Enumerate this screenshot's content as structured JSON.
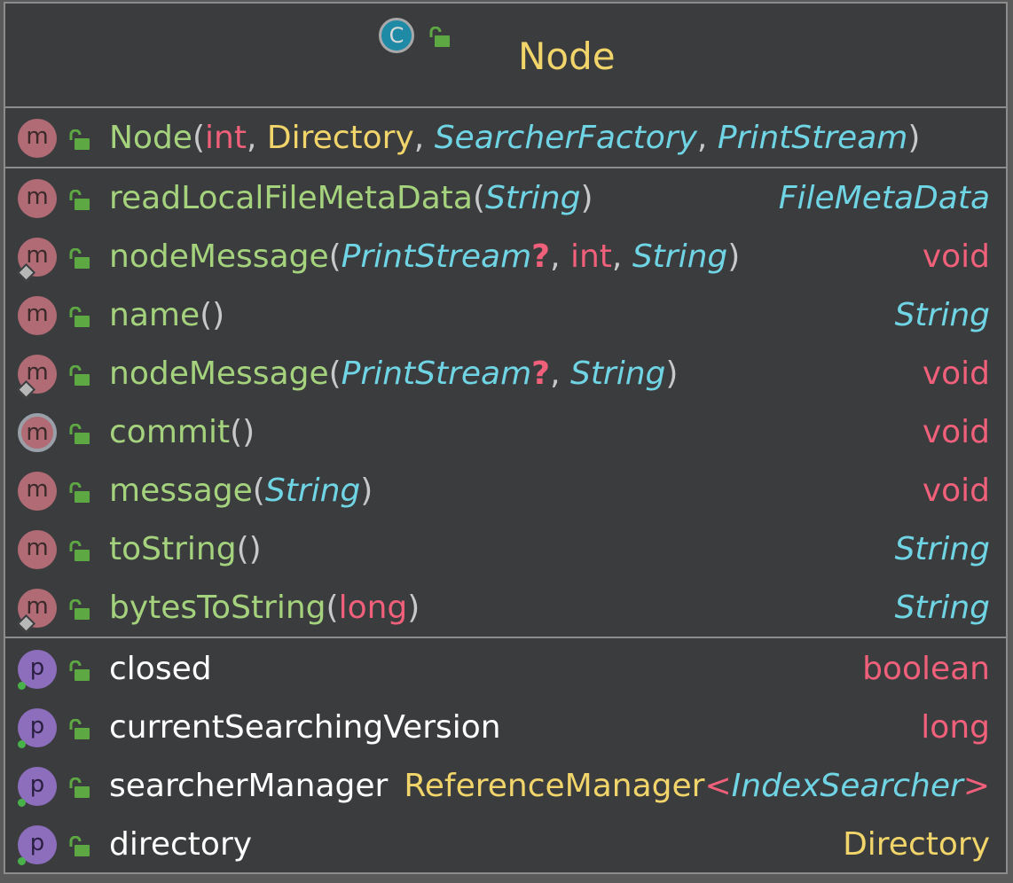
{
  "class": {
    "icon_letter": "C",
    "name": "Node"
  },
  "constructor": {
    "icon_letter": "m",
    "name": "Node",
    "params": [
      "int",
      "Directory",
      "SearcherFactory",
      "PrintStream"
    ]
  },
  "methods": [
    {
      "icon_letter": "m",
      "name": "readLocalFileMetaData",
      "param1": "String",
      "returns": "FileMetaData",
      "marker": "none"
    },
    {
      "icon_letter": "m",
      "name": "nodeMessage",
      "param1": "PrintStream",
      "nullable": "?",
      "param2": "int",
      "param3": "String",
      "returns": "void",
      "marker": "diamond"
    },
    {
      "icon_letter": "m",
      "name": "name",
      "returns": "String",
      "marker": "none"
    },
    {
      "icon_letter": "m",
      "name": "nodeMessage",
      "param1": "PrintStream",
      "nullable": "?",
      "param2": "String",
      "returns": "void",
      "marker": "diamond"
    },
    {
      "icon_letter": "m",
      "name": "commit",
      "returns": "void",
      "marker": "abstract"
    },
    {
      "icon_letter": "m",
      "name": "message",
      "param1": "String",
      "returns": "void",
      "marker": "none"
    },
    {
      "icon_letter": "m",
      "name": "toString",
      "returns": "String",
      "marker": "none"
    },
    {
      "icon_letter": "m",
      "name": "bytesToString",
      "param1": "long",
      "returns": "String",
      "marker": "diamond"
    }
  ],
  "fields": [
    {
      "icon_letter": "p",
      "name": "closed",
      "type": "boolean"
    },
    {
      "icon_letter": "p",
      "name": "currentSearchingVersion",
      "type": "long"
    },
    {
      "icon_letter": "p",
      "name": "searcherManager",
      "type": "ReferenceManager",
      "type_arg": "IndexSearcher"
    },
    {
      "icon_letter": "p",
      "name": "directory",
      "type": "Directory"
    }
  ],
  "punct": {
    "open": "(",
    "close": ")",
    "comma": ",",
    "empty": "()",
    "lt": "<",
    "gt": ">"
  },
  "colors": {
    "method_name": "#a5d37d",
    "field_name": "#ffffff",
    "keyword": "#f0607a",
    "class_type": "#f2d56a",
    "interface_type": "#6fd5e5",
    "title": "#f2d56a"
  },
  "icons": {
    "class": "class-icon",
    "method": "method-icon",
    "property": "property-icon",
    "visibility": "unlocked-padlock-icon",
    "static_marker": "diamond-icon",
    "field_marker": "green-dot-icon"
  }
}
